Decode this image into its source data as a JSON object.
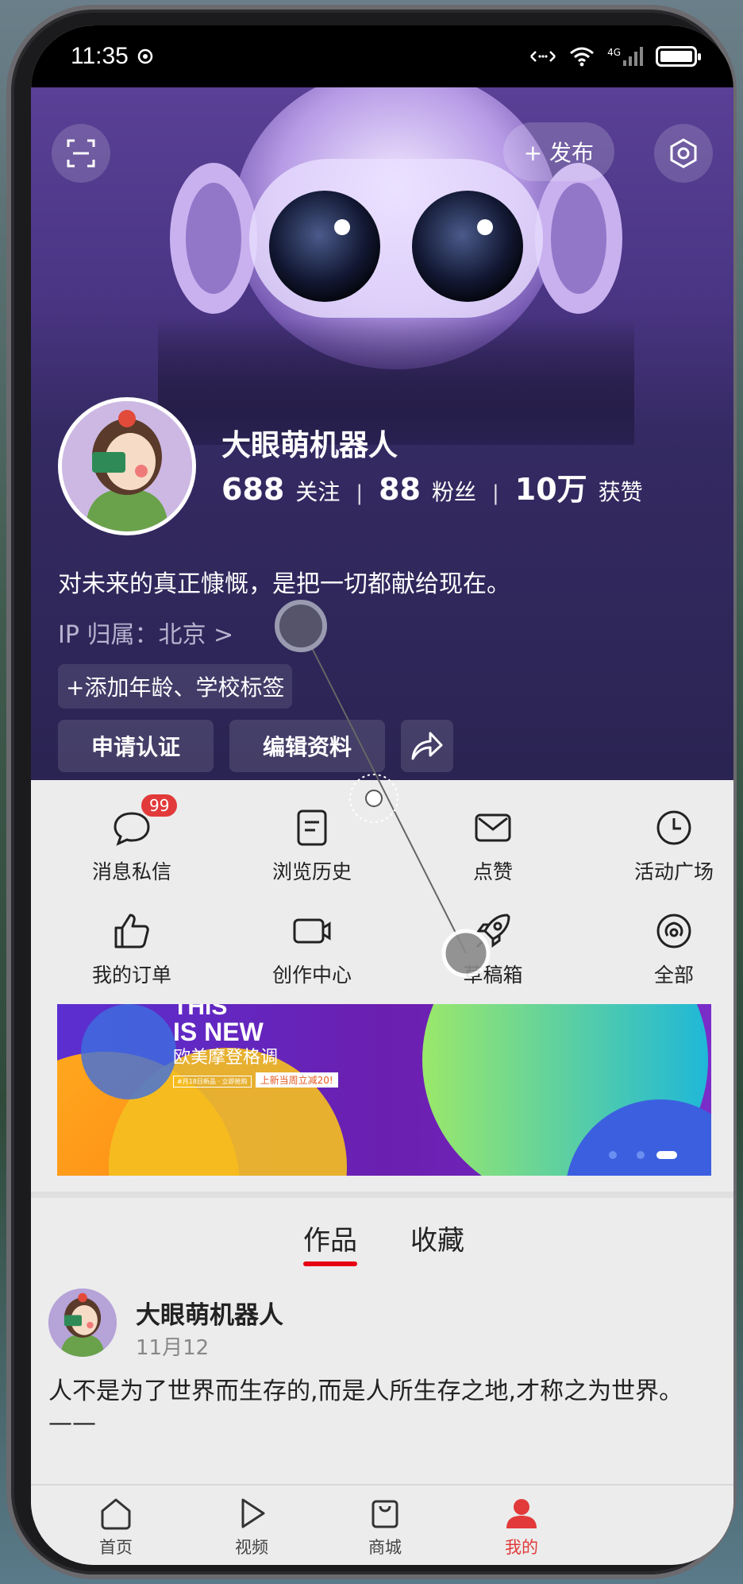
{
  "status_bar": {
    "time": "11:35",
    "network": "4G"
  },
  "header": {
    "publish_label": "+ 发布",
    "username": "大眼萌机器人",
    "stats": [
      {
        "value": "688",
        "label": "关注"
      },
      {
        "value": "88",
        "label": "粉丝"
      },
      {
        "value": "10万",
        "label": "获赞"
      }
    ],
    "bio": "对未来的真正慷慨，是把一切都献给现在。",
    "ip_location": "IP 归属：北京 >",
    "tag_chip": "+添加年龄、学校标签",
    "buttons": {
      "verify": "申请认证",
      "edit_profile": "编辑资料"
    }
  },
  "grid": [
    {
      "label": "消息私信",
      "icon": "chat-bubble-icon",
      "badge": "99"
    },
    {
      "label": "浏览历史",
      "icon": "document-icon"
    },
    {
      "label": "点赞",
      "icon": "mail-icon"
    },
    {
      "label": "活动广场",
      "icon": "clock-icon"
    },
    {
      "label": "我的订单",
      "icon": "thumbs-up-icon"
    },
    {
      "label": "创作中心",
      "icon": "video-camera-icon"
    },
    {
      "label": "草稿箱",
      "icon": "rocket-icon"
    },
    {
      "label": "全部",
      "icon": "broadcast-icon"
    }
  ],
  "banner": {
    "line1": "THIS",
    "line2": "IS NEW",
    "line3": "欧美摩登格调",
    "line4": "#月18日新品 · 立即抢购",
    "line5": "上新当周立减20!"
  },
  "tabs": [
    "作品",
    "收藏"
  ],
  "post": {
    "author": "大眼萌机器人",
    "date": "11月12",
    "text": "人不是为了世界而生存的,而是人所生存之地,才称之为世界。——"
  },
  "bottom_nav": [
    {
      "label": "首页",
      "icon": "home-icon",
      "active": false
    },
    {
      "label": "视频",
      "icon": "play-icon",
      "active": false
    },
    {
      "label": "商城",
      "icon": "shopping-bag-icon",
      "active": false
    },
    {
      "label": "我的",
      "icon": "user-icon",
      "active": true
    }
  ],
  "colors": {
    "accent": "#e60012",
    "header_bg": "#2a2452",
    "badge": "#e23a3a"
  }
}
